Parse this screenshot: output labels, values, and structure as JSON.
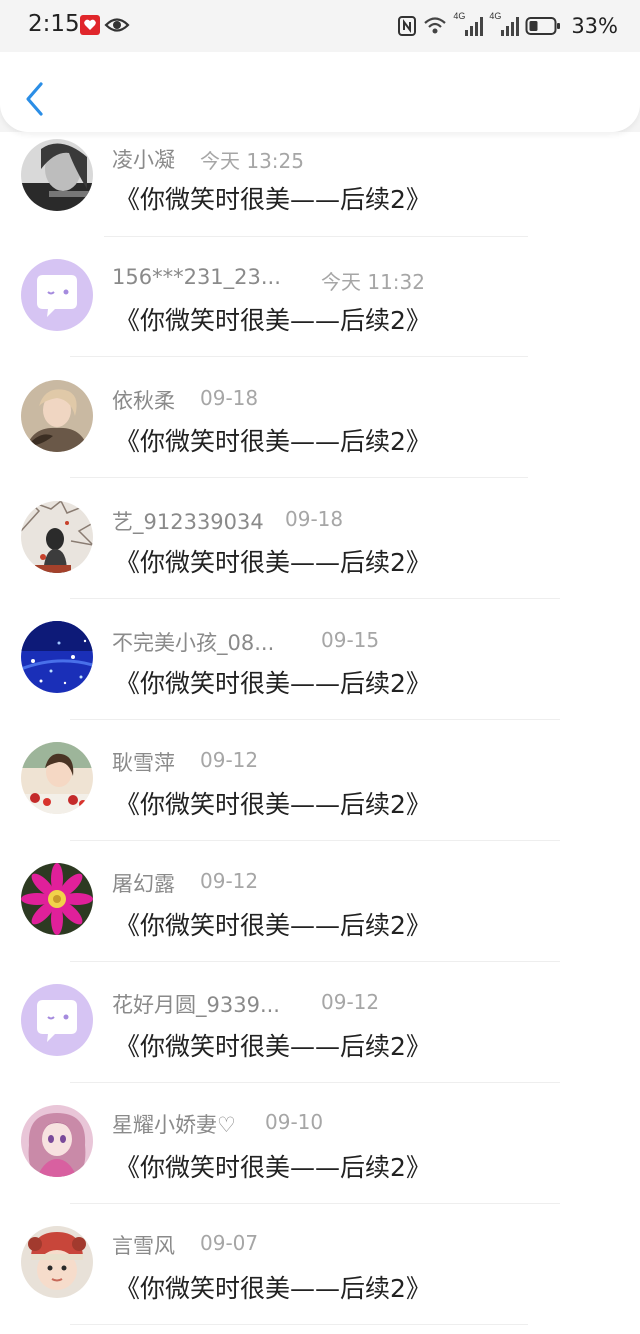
{
  "status_bar": {
    "time": "2:15",
    "network_1": "4G",
    "network_2": "4G",
    "battery": "33%"
  },
  "header": {
    "back_icon": "chevron-left-icon",
    "accent_color": "#2b8ee6"
  },
  "items": [
    {
      "name": "凌小凝",
      "time": "今天 13:25",
      "title": "《你微笑时很美——后续2》",
      "avatar": "photo-girl-bw"
    },
    {
      "name": "156***231_23...",
      "time": "今天 11:32",
      "title": "《你微笑时很美——后续2》",
      "avatar": "default-chat-bubble"
    },
    {
      "name": "依秋柔",
      "time": "09-18",
      "title": "《你微笑时很美——后续2》",
      "avatar": "photo-woman-fur"
    },
    {
      "name": "艺_912339034",
      "time": "09-18",
      "title": "《你微笑时很美——后续2》",
      "avatar": "photo-tree-girl"
    },
    {
      "name": "不完美小孩_08...",
      "time": "09-15",
      "title": "《你微笑时很美——后续2》",
      "avatar": "photo-blue-sparkle"
    },
    {
      "name": "耿雪萍",
      "time": "09-12",
      "title": "《你微笑时很美——后续2》",
      "avatar": "photo-girl-roses"
    },
    {
      "name": "屠幻露",
      "time": "09-12",
      "title": "《你微笑时很美——后续2》",
      "avatar": "photo-pink-flower"
    },
    {
      "name": "花好月圆_9339...",
      "time": "09-12",
      "title": "《你微笑时很美——后续2》",
      "avatar": "default-chat-bubble"
    },
    {
      "name": "星耀小娇妻♡",
      "time": "09-10",
      "title": "《你微笑时很美——后续2》",
      "avatar": "photo-anime-doll"
    },
    {
      "name": "言雪风",
      "time": "09-07",
      "title": "《你微笑时很美——后续2》",
      "avatar": "photo-child-hat"
    }
  ]
}
